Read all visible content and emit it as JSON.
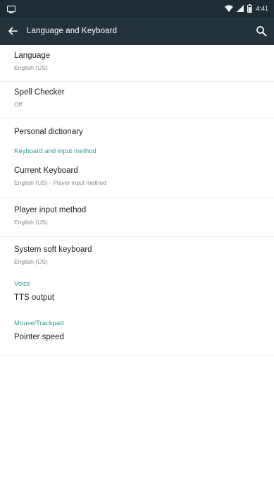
{
  "status_bar": {
    "time": "4:41",
    "icons": [
      "notification-icon",
      "wifi-icon",
      "signal-icon",
      "battery-icon"
    ]
  },
  "toolbar": {
    "title": "Language and Keyboard",
    "back_icon": "arrow-back-icon",
    "search_icon": "search-icon"
  },
  "colors": {
    "toolbar": "#243239",
    "status_bar": "#1f2b32",
    "accent": "#2f9c96"
  },
  "settings": {
    "language": {
      "title": "Language",
      "summary": "English (US)"
    },
    "spell_checker": {
      "title": "Spell Checker",
      "summary": "Off"
    },
    "personal_dictionary": {
      "title": "Personal dictionary"
    },
    "keyboard_header": "Keyboard and input method",
    "current_keyboard": {
      "title": "Current Keyboard",
      "summary": "English (US) - Player input method"
    },
    "player_input_method": {
      "title": "Player input method",
      "summary": "English (US)"
    },
    "system_soft_keyboard": {
      "title": "System soft keyboard",
      "summary": "English (US)"
    },
    "voice_header": "Voice",
    "tts_output": {
      "title": "TTS output"
    },
    "mouse_header": "Mouse/Trackpad",
    "pointer_speed": {
      "title": "Pointer speed"
    }
  }
}
